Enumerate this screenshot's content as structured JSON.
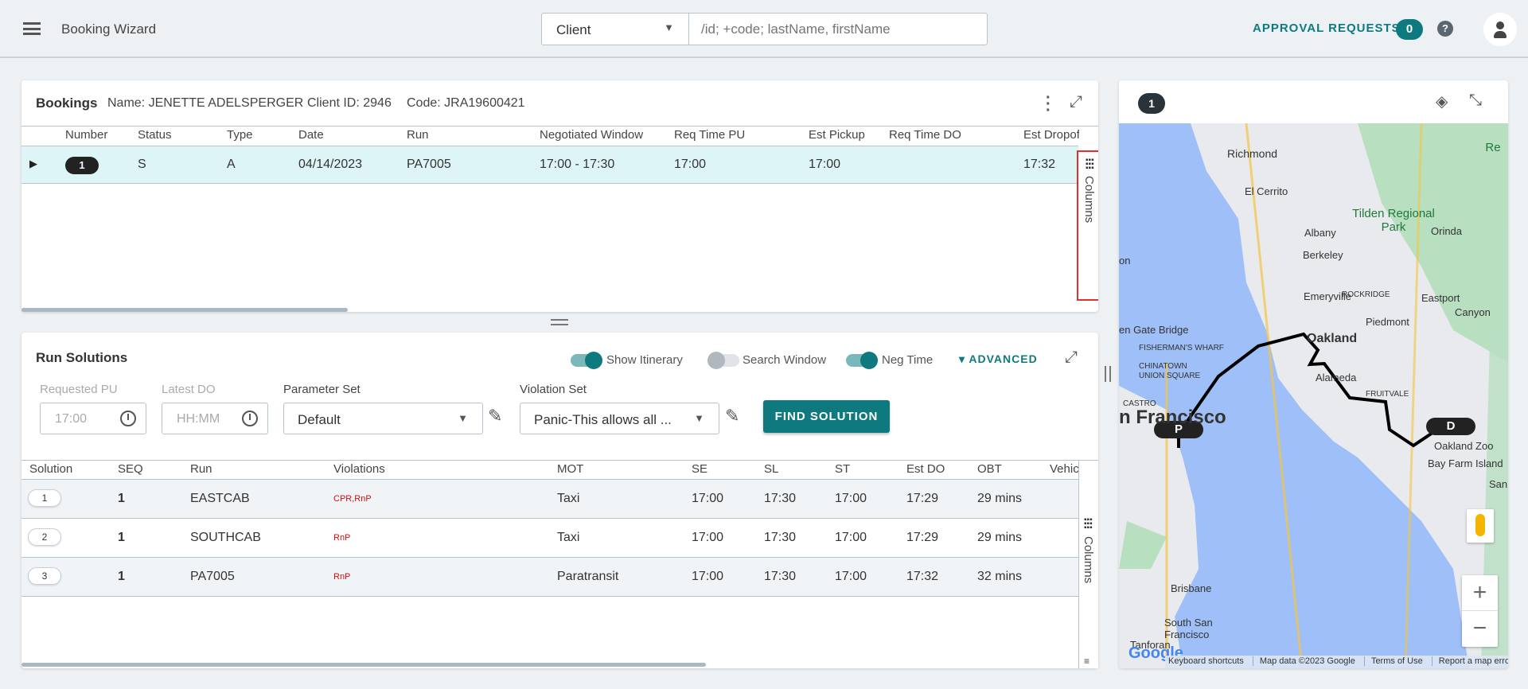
{
  "header": {
    "title": "Booking Wizard",
    "search_type": "Client",
    "search_placeholder": "/id; +code; lastName, firstName",
    "approval_label": "APPROVAL REQUESTS",
    "approval_count": "0"
  },
  "bookings": {
    "title": "Bookings",
    "name": "Name: JENETTE ADELSPERGER",
    "client_id": "Client ID: 2946",
    "code": "Code: JRA19600421",
    "columns_label": "Columns",
    "headers": [
      "Number",
      "Status",
      "Type",
      "Date",
      "Run",
      "Negotiated Window",
      "Req Time PU",
      "Est Pickup",
      "Req Time DO",
      "Est Dropoff"
    ],
    "rows": [
      {
        "number": "1",
        "status": "S",
        "type": "A",
        "date": "04/14/2023",
        "run": "PA7005",
        "window": "17:00 - 17:30",
        "req_pu": "17:00",
        "est_pickup": "17:00",
        "req_do": "",
        "est_dropoff": "17:32"
      }
    ]
  },
  "run_solutions": {
    "title": "Run Solutions",
    "toggles": [
      {
        "label": "Show Itinerary",
        "on": true
      },
      {
        "label": "Search Window",
        "on": false
      },
      {
        "label": "Neg Time",
        "on": true
      }
    ],
    "advanced": "ADVANCED",
    "requested_pu_label": "Requested PU",
    "requested_pu_value": "17:00",
    "latest_do_label": "Latest DO",
    "latest_do_placeholder": "HH:MM",
    "parameter_set_label": "Parameter Set",
    "parameter_set_value": "Default",
    "violation_set_label": "Violation Set",
    "violation_set_value": "Panic-This allows all ...",
    "find_button": "FIND SOLUTION",
    "columns_label": "Columns",
    "headers": [
      "Solution",
      "SEQ",
      "Run",
      "Violations",
      "MOT",
      "SE",
      "SL",
      "ST",
      "Est DO",
      "OBT",
      "Vehic"
    ],
    "rows": [
      {
        "solution": "1",
        "seq": "1",
        "run": "EASTCAB",
        "violations": "CPR,RnP",
        "mot": "Taxi",
        "se": "17:00",
        "sl": "17:30",
        "st": "17:00",
        "est_do": "17:29",
        "obt": "29 mins"
      },
      {
        "solution": "2",
        "seq": "1",
        "run": "SOUTHCAB",
        "violations": "RnP",
        "mot": "Taxi",
        "se": "17:00",
        "sl": "17:30",
        "st": "17:00",
        "est_do": "17:29",
        "obt": "29 mins"
      },
      {
        "solution": "3",
        "seq": "1",
        "run": "PA7005",
        "violations": "RnP",
        "mot": "Paratransit",
        "se": "17:00",
        "sl": "17:30",
        "st": "17:00",
        "est_do": "17:32",
        "obt": "32 mins"
      }
    ]
  },
  "map": {
    "badge": "1",
    "pickup_marker": "P",
    "dropoff_marker": "D",
    "labels": [
      "Richmond",
      "El Cerrito",
      "Albany",
      "Berkeley",
      "Emeryville",
      "Oakland",
      "Piedmont",
      "Alameda",
      "Orinda",
      "Eastport",
      "Canyon",
      "ROCKRIDGE",
      "FRUITVALE",
      "Oakland Zoo",
      "Bay Farm Island",
      "San Le",
      "Brisbane",
      "South San Francisco",
      "Tanforan",
      "CHINATOWN",
      "UNION SQUARE",
      "FISHERMAN'S WHARF",
      "CASTRO",
      "en Gate Bridge",
      "n Francisco",
      "on"
    ],
    "parks": [
      "Tilden Regional Park",
      "Re"
    ],
    "footer": {
      "keyboard": "Keyboard shortcuts",
      "data": "Map data ©2023 Google",
      "terms": "Terms of Use",
      "report": "Report a map error"
    },
    "zoom_in": "+",
    "zoom_out": "−",
    "google": "Google"
  },
  "colors": {
    "accent": "#0e7a80",
    "row_selected": "#def5f8",
    "violation": "#cc1111"
  }
}
